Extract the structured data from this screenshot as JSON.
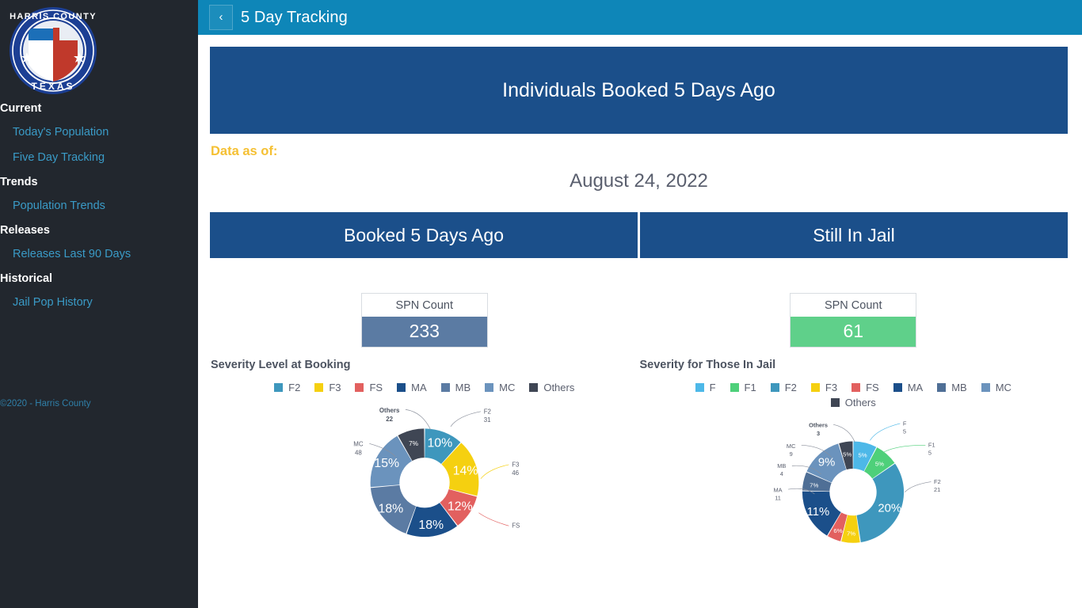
{
  "sidebar": {
    "logo_alt": "Harris County Texas seal",
    "groups": [
      {
        "header": "Current",
        "items": [
          {
            "label": "Today's Population"
          },
          {
            "label": "Five Day Tracking"
          }
        ]
      },
      {
        "header": "Trends",
        "items": [
          {
            "label": "Population Trends"
          }
        ]
      },
      {
        "header": "Releases",
        "items": [
          {
            "label": "Releases Last 90 Days"
          }
        ]
      },
      {
        "header": "Historical",
        "items": [
          {
            "label": "Jail Pop History"
          }
        ]
      }
    ],
    "copyright": "©2020 - Harris County"
  },
  "topbar": {
    "back_icon": "chevron-left-icon",
    "title": "5 Day Tracking",
    "bg_color": "#0e86b8"
  },
  "banner": {
    "title": "Individuals Booked 5 Days Ago",
    "bg_color": "#1b4f8a"
  },
  "data_as_of": {
    "label": "Data as of:",
    "label_color": "#f5c033",
    "value": "August 24, 2022"
  },
  "tabs": [
    {
      "label": "Booked 5 Days Ago"
    },
    {
      "label": "Still In Jail"
    }
  ],
  "left_panel": {
    "kpi": {
      "title": "SPN Count",
      "value": "233",
      "color": "#5b7ba3"
    },
    "chart_title": "Severity Level at Booking"
  },
  "right_panel": {
    "kpi": {
      "title": "SPN Count",
      "value": "61",
      "color": "#5fd08a"
    },
    "chart_title": "Severity for Those In Jail"
  },
  "chart_data": [
    {
      "type": "pie",
      "variant": "donut",
      "title": "Severity Level at Booking",
      "panel": "Booked 5 Days Ago",
      "total": 233,
      "legend_position": "top",
      "labels": [
        "F2",
        "F3",
        "FS",
        "MA",
        "MB",
        "MC",
        "Others"
      ],
      "values": [
        31,
        46,
        28,
        42,
        48,
        48,
        22
      ],
      "percents": [
        "10%",
        "14%",
        "12%",
        "18%",
        "18%",
        "15%",
        "7%"
      ],
      "colors": [
        "#3e97bd",
        "#f5d010",
        "#e2605f",
        "#1b4f8a",
        "#5b7ba3",
        "#6b93bd",
        "#3f4654"
      ],
      "visible_percent_labels": [
        "10%",
        "14%",
        "12%",
        "18%",
        "15%",
        "7%"
      ],
      "leader_labels": [
        {
          "name": "F2",
          "value": "31",
          "bold": false
        },
        {
          "name": "F3",
          "value": "46",
          "bold": false
        },
        {
          "name": "FS",
          "value": "",
          "bold": false
        },
        {
          "name": "MC",
          "value": "48",
          "bold": false
        },
        {
          "name": "Others",
          "value": "22",
          "bold": true
        }
      ]
    },
    {
      "type": "pie",
      "variant": "donut",
      "title": "Severity for Those In Jail",
      "panel": "Still In Jail",
      "total": 61,
      "legend_position": "top",
      "labels": [
        "F",
        "F1",
        "F2",
        "F3",
        "FS",
        "MA",
        "MB",
        "MC",
        "Others"
      ],
      "values": [
        5,
        5,
        21,
        4,
        3,
        11,
        4,
        9,
        3
      ],
      "percents": [
        "5%",
        "5%",
        "20%",
        "7%",
        "6%",
        "11%",
        "7%",
        "9%",
        "5%"
      ],
      "colors": [
        "#4db8e8",
        "#4ed07a",
        "#3e97bd",
        "#f5d010",
        "#e2605f",
        "#1b4f8a",
        "#4f6f96",
        "#6b93bd",
        "#3f4654"
      ],
      "visible_percent_labels": [
        "5%",
        "5%",
        "20%",
        "11%",
        "9%"
      ],
      "leader_labels": [
        {
          "name": "F",
          "value": "5",
          "bold": false
        },
        {
          "name": "F1",
          "value": "5",
          "bold": false
        },
        {
          "name": "F2",
          "value": "21",
          "bold": false
        },
        {
          "name": "MA",
          "value": "11",
          "bold": false
        },
        {
          "name": "MB",
          "value": "4",
          "bold": false
        },
        {
          "name": "MC",
          "value": "9",
          "bold": false
        },
        {
          "name": "Others",
          "value": "3",
          "bold": true
        }
      ]
    }
  ]
}
